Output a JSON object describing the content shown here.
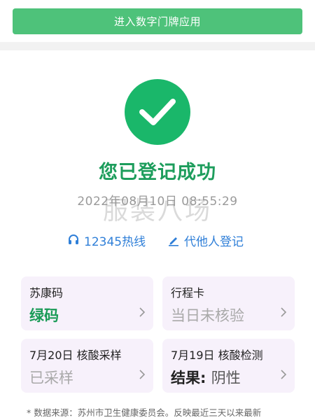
{
  "header": {
    "enter_button_label": "进入数字门牌应用"
  },
  "status": {
    "title": "您已登记成功",
    "timestamp": "2022年08月10日 08:55:29",
    "watermark": "服装八场"
  },
  "links": {
    "hotline_label": "12345热线",
    "proxy_label": "代他人登记"
  },
  "cards": [
    {
      "label": "苏康码",
      "value": "绿码"
    },
    {
      "label": "行程卡",
      "value": "当日未核验"
    },
    {
      "label": "7月20日 核酸采样",
      "value": "已采样"
    },
    {
      "label": "7月19日 核酸检测",
      "value_prefix": "结果:",
      "value_result": "阴性"
    }
  ],
  "footer": {
    "text": "* 数据来源：苏州市卫生健康委员会。反映最近三天以来最新"
  },
  "colors": {
    "accent_green": "#1ab76a",
    "link_blue": "#2f7fd8",
    "button_green": "#4ec27a"
  }
}
